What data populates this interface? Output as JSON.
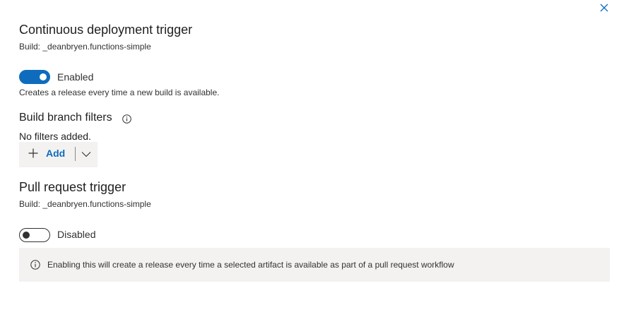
{
  "panel": {
    "close_icon": "close-icon"
  },
  "continuous_deployment": {
    "title": "Continuous deployment trigger",
    "build": "Build: _deanbryen.functions-simple",
    "toggle_state": true,
    "toggle_label": "Enabled",
    "description": "Creates a release every time a new build is available."
  },
  "build_branch_filters": {
    "title": "Build branch filters",
    "info_icon": "info-icon",
    "empty_text": "No filters added.",
    "add_label": "Add",
    "add_icon": "plus-icon",
    "dropdown_icon": "chevron-down-icon"
  },
  "pull_request": {
    "title": "Pull request trigger",
    "build": "Build: _deanbryen.functions-simple",
    "toggle_state": false,
    "toggle_label": "Disabled",
    "info_message": "Enabling this will create a release every time a selected artifact is available as part of a pull request workflow",
    "info_icon": "info-icon"
  },
  "colors": {
    "accent": "#0f6cbd",
    "info_bar_bg": "#f3f2f1",
    "text_primary": "#201f1e"
  }
}
